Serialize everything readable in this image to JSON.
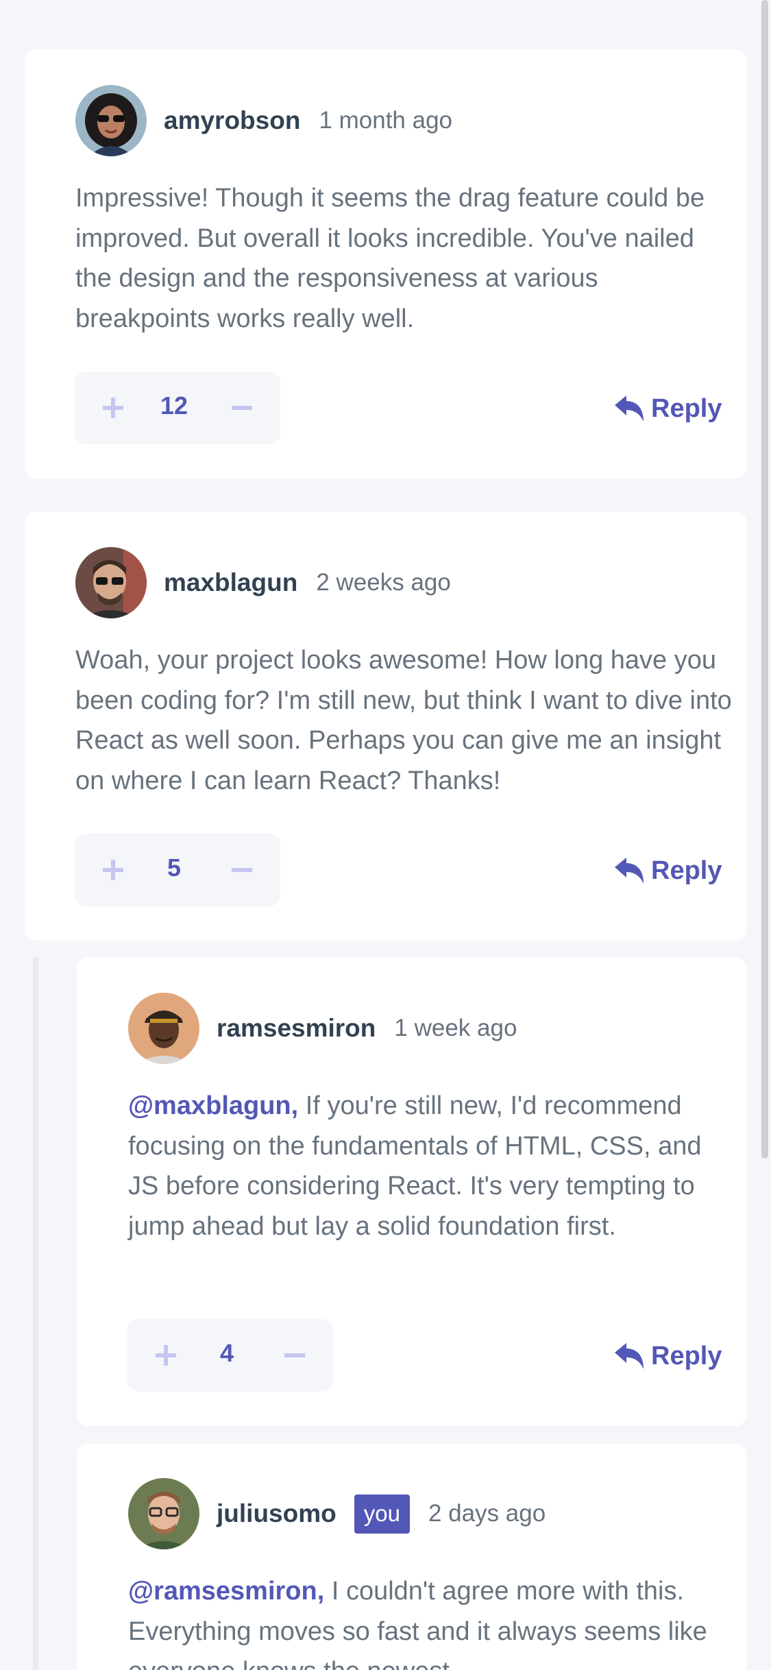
{
  "comments": [
    {
      "username": "amyrobson",
      "timestamp": "1 month ago",
      "is_you": false,
      "mention": "",
      "text": "Impressive! Though it seems the drag feature could be improved. But overall it looks incredible. You've nailed the design and the responsiveness at various breakpoints works really well.",
      "score": "12",
      "reply_label": "Reply"
    },
    {
      "username": "maxblagun",
      "timestamp": "2 weeks ago",
      "is_you": false,
      "mention": "",
      "text": "Woah, your project looks awesome! How long have you been coding for? I'm still new, but think I want to dive into React as well soon. Perhaps you can give me an insight on where I can learn React? Thanks!",
      "score": "5",
      "reply_label": "Reply"
    }
  ],
  "replies": [
    {
      "username": "ramsesmiron",
      "timestamp": "1 week ago",
      "is_you": false,
      "mention": "@maxblagun,",
      "text": "If you're still new, I'd recommend focusing on the fundamentals of HTML, CSS, and JS before considering React. It's very tempting to jump ahead but lay a solid foundation first.",
      "score": "4",
      "reply_label": "Reply"
    },
    {
      "username": "juliusomo",
      "timestamp": "2 days ago",
      "is_you": true,
      "you_label": "you",
      "mention": "@ramsesmiron,",
      "text": "I couldn't agree more with this. Everything moves so fast and it always seems like everyone knows the newest..."
    }
  ],
  "colors": {
    "accent": "#5357b6",
    "accent_light": "#c5c6ef",
    "text": "#67727e",
    "heading": "#324152",
    "background": "#f5f6fa",
    "card": "#ffffff"
  },
  "icons": {
    "upvote": "plus-icon",
    "downvote": "minus-icon",
    "reply": "reply-arrow-icon"
  }
}
